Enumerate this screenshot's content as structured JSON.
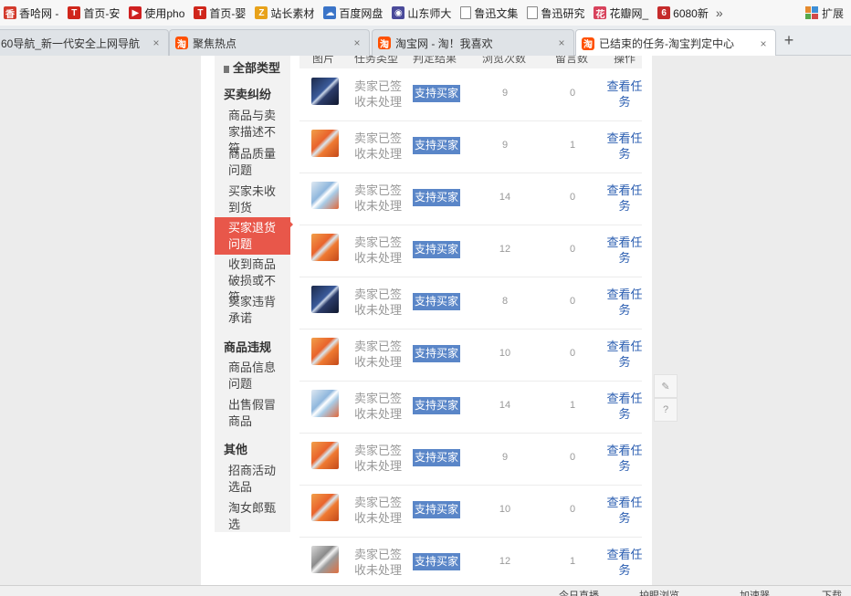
{
  "bookmarks": [
    {
      "label": "香哈网 -",
      "icon": "xianghha-icon",
      "color": "#d33a2c",
      "glyph": "香"
    },
    {
      "label": "首页-安",
      "icon": "toutiao-icon",
      "color": "#d0261b",
      "glyph": "T"
    },
    {
      "label": "使用pho",
      "icon": "play-icon",
      "color": "#cf2020",
      "glyph": "▶"
    },
    {
      "label": "首页-婴",
      "icon": "toutiao-icon",
      "color": "#d0261b",
      "glyph": "T"
    },
    {
      "label": "站长素材",
      "icon": "chinaz-icon",
      "color": "#e8a21a",
      "glyph": "Z"
    },
    {
      "label": "百度网盘",
      "icon": "cloud-icon",
      "color": "#3a74c8",
      "glyph": "☁"
    },
    {
      "label": "山东师大",
      "icon": "university-icon",
      "color": "#4a4a9a",
      "glyph": "◉"
    },
    {
      "label": "鲁迅文集",
      "icon": "page-icon",
      "color": "#ffffff",
      "glyph": ""
    },
    {
      "label": "鲁迅研究",
      "icon": "page-icon",
      "color": "#ffffff",
      "glyph": ""
    },
    {
      "label": "花瓣网_",
      "icon": "huaban-icon",
      "color": "#d8425c",
      "glyph": "花"
    },
    {
      "label": "6080新",
      "icon": "6080-icon",
      "color": "#c52b2b",
      "glyph": "6"
    }
  ],
  "bookmarks_more": "»",
  "extensions_label": "扩展",
  "tabs": [
    {
      "title": "60导航_新一代安全上网导航",
      "active": false
    },
    {
      "title": "聚焦热点",
      "active": false
    },
    {
      "title": "淘宝网 - 淘！我喜欢",
      "active": false
    },
    {
      "title": "已结束的任务-淘宝判定中心",
      "active": true
    }
  ],
  "tab_favicon": "淘",
  "tab_close": "×",
  "new_tab": "+",
  "sidebar": {
    "all_types": "全部类型",
    "categories": [
      {
        "title": "买卖纠纷",
        "items": [
          "商品与卖家描述不符",
          "商品质量问题",
          "买家未收到货",
          "买家退货问题",
          "收到商品破损或不符",
          "卖家违背承诺"
        ],
        "active_index": 3
      },
      {
        "title": "商品违规",
        "items": [
          "商品信息问题",
          "出售假冒商品"
        ]
      },
      {
        "title": "其他",
        "items": [
          "招商活动选品",
          "淘女郎甄选"
        ]
      }
    ]
  },
  "table": {
    "headers": [
      "图片",
      "任务类型",
      "判定结果",
      "浏览次数",
      "留言数",
      "操作"
    ],
    "rows": [
      {
        "thumb": "dark",
        "type": "卖家已签收未处理",
        "result": "支持买家",
        "views": "9",
        "msgs": "0",
        "action": "查看任务"
      },
      {
        "thumb": "orange",
        "type": "卖家已签收未处理",
        "result": "支持买家",
        "views": "9",
        "msgs": "1",
        "action": "查看任务"
      },
      {
        "thumb": "light",
        "type": "卖家已签收未处理",
        "result": "支持买家",
        "views": "14",
        "msgs": "0",
        "action": "查看任务"
      },
      {
        "thumb": "orange",
        "type": "卖家已签收未处理",
        "result": "支持买家",
        "views": "12",
        "msgs": "0",
        "action": "查看任务"
      },
      {
        "thumb": "dark",
        "type": "卖家已签收未处理",
        "result": "支持买家",
        "views": "8",
        "msgs": "0",
        "action": "查看任务"
      },
      {
        "thumb": "orange",
        "type": "卖家已签收未处理",
        "result": "支持买家",
        "views": "10",
        "msgs": "0",
        "action": "查看任务"
      },
      {
        "thumb": "light",
        "type": "卖家已签收未处理",
        "result": "支持买家",
        "views": "14",
        "msgs": "1",
        "action": "查看任务"
      },
      {
        "thumb": "orange",
        "type": "卖家已签收未处理",
        "result": "支持买家",
        "views": "9",
        "msgs": "0",
        "action": "查看任务"
      },
      {
        "thumb": "orange",
        "type": "卖家已签收未处理",
        "result": "支持买家",
        "views": "10",
        "msgs": "0",
        "action": "查看任务"
      },
      {
        "thumb": "grey",
        "type": "卖家已签收未处理",
        "result": "支持买家",
        "views": "12",
        "msgs": "1",
        "action": "查看任务"
      }
    ]
  },
  "float_tools": [
    {
      "name": "edit-icon",
      "glyph": "✎"
    },
    {
      "name": "help-icon",
      "glyph": "?"
    }
  ],
  "status_bar": [
    "今日直播",
    "护眼浏览",
    "加速器",
    "下载"
  ],
  "colors": {
    "active_sidebar": "#e8574a",
    "result_badge": "#5a86c8",
    "link": "#2a5db0",
    "taobao": "#ff5000"
  }
}
